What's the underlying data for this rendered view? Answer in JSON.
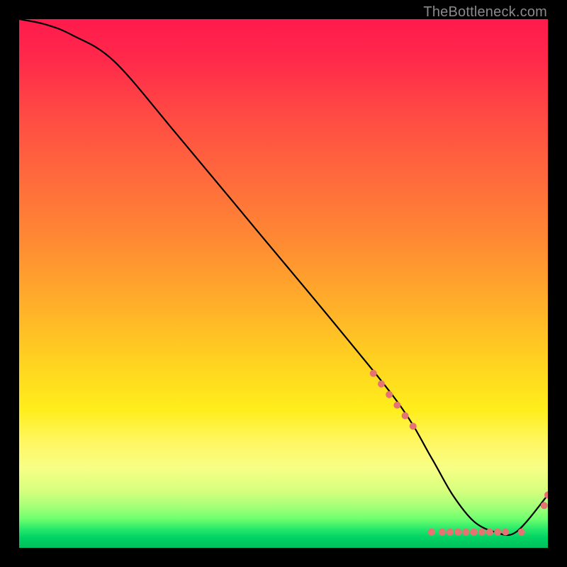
{
  "watermark": "TheBottleneck.com",
  "chart_data": {
    "type": "line",
    "title": "",
    "xlabel": "",
    "ylabel": "",
    "xlim": [
      0,
      100
    ],
    "ylim": [
      0,
      100
    ],
    "series": [
      {
        "name": "curve",
        "x": [
          0,
          5,
          10,
          18,
          30,
          45,
          60,
          72,
          78,
          82,
          86,
          90,
          94,
          100
        ],
        "y": [
          100,
          99,
          97,
          92,
          78,
          60,
          42,
          27,
          17,
          10,
          5,
          3,
          3,
          10
        ]
      }
    ],
    "markers": {
      "name": "dots",
      "color": "#e57373",
      "x": [
        67,
        68.5,
        70,
        71.5,
        73,
        74.5,
        78,
        80,
        81.5,
        83,
        84.5,
        86,
        87.5,
        89,
        90.5,
        92,
        95,
        99.3,
        100
      ],
      "y": [
        33,
        31,
        29,
        27,
        25,
        23,
        3,
        3,
        3,
        3,
        3,
        3,
        3,
        3,
        3,
        3,
        3,
        8,
        10
      ]
    },
    "gradient_stops": [
      {
        "pos": 0.0,
        "color": "#ff1a4d"
      },
      {
        "pos": 0.3,
        "color": "#ff6a3c"
      },
      {
        "pos": 0.55,
        "color": "#ffb229"
      },
      {
        "pos": 0.75,
        "color": "#ffee1c"
      },
      {
        "pos": 0.9,
        "color": "#a8ff78"
      },
      {
        "pos": 1.0,
        "color": "#00c05c"
      }
    ]
  }
}
